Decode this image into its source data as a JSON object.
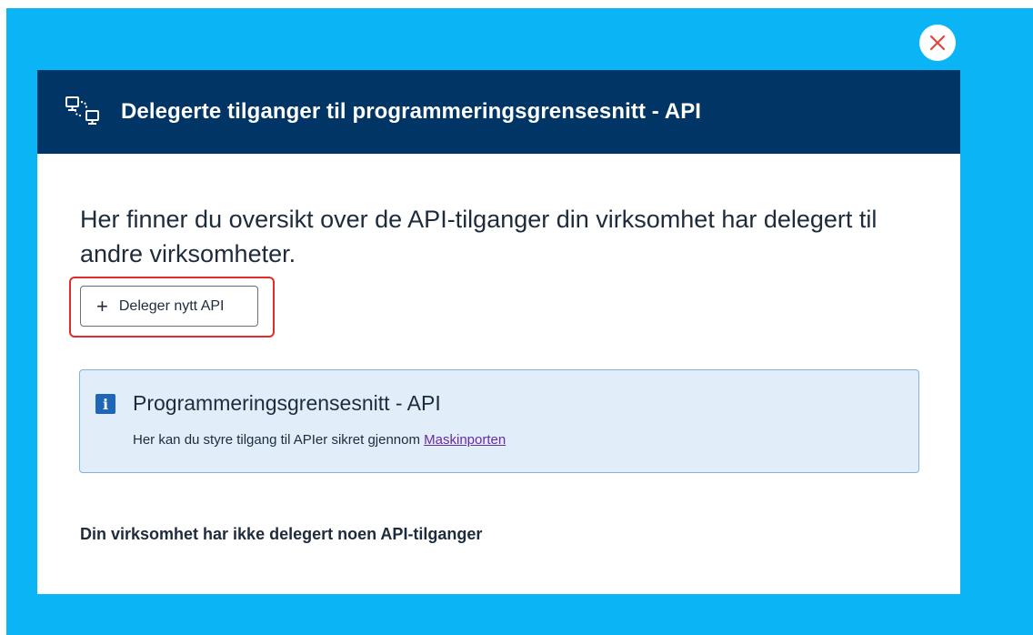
{
  "modal": {
    "title": "Delegerte tilganger til programmeringsgrensesnitt - API",
    "header_icon": "computers-icon",
    "close_icon": "close-icon"
  },
  "main": {
    "lead_text": "Her finner du oversikt over de API-tilganger din virksomhet har delegert til andre virksomheter.",
    "add_button": {
      "icon": "plus-icon",
      "plus_glyph": "+",
      "label": "Deleger nytt API"
    },
    "info_box": {
      "icon": "info-icon",
      "icon_glyph": "i",
      "title": "Programmeringsgrensesnitt - API",
      "text": "Her kan du styre tilgang til APIer sikret gjennom",
      "link_text": "Maskinporten"
    },
    "empty_message": "Din virksomhet har ikke delegert noen API-tilganger"
  },
  "colors": {
    "backdrop": "#0bb4f5",
    "header": "#003566",
    "highlight": "#e32b2b",
    "info_bg": "#e1eef9",
    "link": "#6a2aa3"
  }
}
